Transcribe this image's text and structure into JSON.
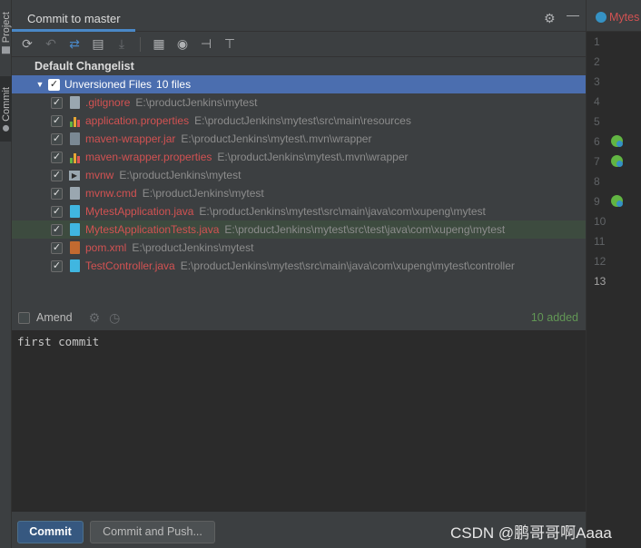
{
  "tool_strip": {
    "project_label": "Project",
    "commit_label": "Commit"
  },
  "panel": {
    "tab_title": "Commit to master",
    "settings_icon": "gear-icon",
    "hide_icon": "minimize-icon"
  },
  "toolbar": {
    "icons": [
      "refresh-icon",
      "rollback-icon",
      "diff-icon",
      "show-diff-icon",
      "shelve-icon",
      "group-by-icon",
      "eye-icon",
      "expand-all-icon",
      "collapse-all-icon"
    ]
  },
  "changelist": {
    "title": "Default Changelist",
    "group": {
      "label": "Unversioned Files",
      "count": "10 files",
      "checked": true
    },
    "files": [
      {
        "name": ".gitignore",
        "path": "E:\\productJenkins\\mytest",
        "icon": "gitignore-icon",
        "checked": true
      },
      {
        "name": "application.properties",
        "path": "E:\\productJenkins\\mytest\\src\\main\\resources",
        "icon": "properties-icon",
        "checked": true
      },
      {
        "name": "maven-wrapper.jar",
        "path": "E:\\productJenkins\\mytest\\.mvn\\wrapper",
        "icon": "jar-icon",
        "checked": true
      },
      {
        "name": "maven-wrapper.properties",
        "path": "E:\\productJenkins\\mytest\\.mvn\\wrapper",
        "icon": "properties-icon",
        "checked": true
      },
      {
        "name": "mvnw",
        "path": "E:\\productJenkins\\mytest",
        "icon": "shell-icon",
        "checked": true
      },
      {
        "name": "mvnw.cmd",
        "path": "E:\\productJenkins\\mytest",
        "icon": "text-file-icon",
        "checked": true
      },
      {
        "name": "MytestApplication.java",
        "path": "E:\\productJenkins\\mytest\\src\\main\\java\\com\\xupeng\\mytest",
        "icon": "java-class-icon",
        "checked": true
      },
      {
        "name": "MytestApplicationTests.java",
        "path": "E:\\productJenkins\\mytest\\src\\test\\java\\com\\xupeng\\mytest",
        "icon": "java-class-icon",
        "checked": true
      },
      {
        "name": "pom.xml",
        "path": "E:\\productJenkins\\mytest",
        "icon": "maven-pom-icon",
        "checked": true
      },
      {
        "name": "TestController.java",
        "path": "E:\\productJenkins\\mytest\\src\\main\\java\\com\\xupeng\\mytest\\controller",
        "icon": "java-class-icon",
        "checked": true
      }
    ]
  },
  "amend": {
    "label": "Amend",
    "checked": false,
    "added_status": "10 added"
  },
  "commit_message": "first commit",
  "actions": {
    "commit_label": "Commit",
    "commit_push_label": "Commit and Push..."
  },
  "editor": {
    "tab_label": "Mytes",
    "line_numbers": [
      "1",
      "2",
      "3",
      "4",
      "5",
      "6",
      "7",
      "8",
      "9",
      "10",
      "11",
      "12",
      "13"
    ]
  },
  "watermark": "CSDN @鹏哥哥啊Aaaa",
  "colors": {
    "unversioned_file": "#d25252",
    "selection": "#4b6eaf",
    "added_status": "#629755",
    "primary_button": "#365880"
  }
}
